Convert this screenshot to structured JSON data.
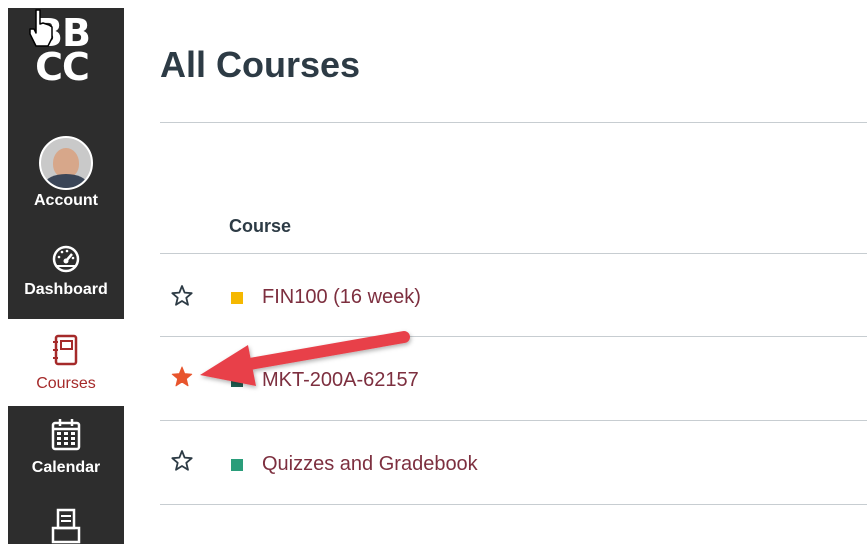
{
  "app": {
    "logo_line1": "BB",
    "logo_line2": "CC"
  },
  "sidebar": {
    "items": [
      {
        "label": "Account",
        "icon": "avatar"
      },
      {
        "label": "Dashboard",
        "icon": "dashboard-icon"
      },
      {
        "label": "Courses",
        "icon": "courses-icon",
        "active": true
      },
      {
        "label": "Calendar",
        "icon": "calendar-icon"
      },
      {
        "label": "",
        "icon": "inbox-icon"
      }
    ]
  },
  "page": {
    "title": "All Courses"
  },
  "table": {
    "column_header": "Course",
    "rows": [
      {
        "name": "FIN100 (16 week)",
        "favorite": false,
        "color": "#f5b800"
      },
      {
        "name": "MKT-200A-62157",
        "favorite": true,
        "color": "#1f5e52"
      },
      {
        "name": "Quizzes and Gradebook",
        "favorite": false,
        "color": "#2a9d7a"
      }
    ]
  },
  "colors": {
    "sidebar_bg": "#2d2d2d",
    "active_nav": "#a52a2a",
    "link": "#7d2f3f",
    "star_active": "#e8552d",
    "annotation_arrow": "#e8414a"
  }
}
